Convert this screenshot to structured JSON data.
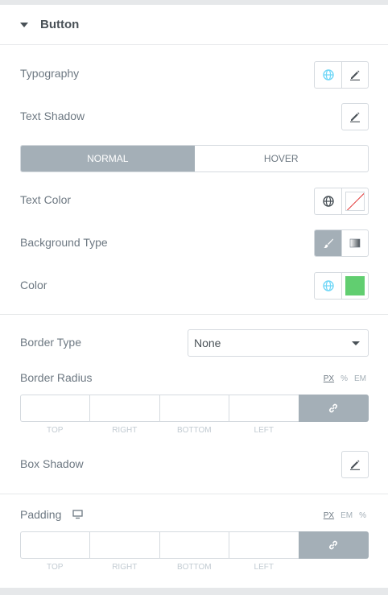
{
  "section": {
    "title": "Button"
  },
  "typography": {
    "label": "Typography"
  },
  "text_shadow": {
    "label": "Text Shadow"
  },
  "state_tabs": [
    {
      "label": "NORMAL",
      "active": true
    },
    {
      "label": "HOVER",
      "active": false
    }
  ],
  "text_color": {
    "label": "Text Color"
  },
  "background_type": {
    "label": "Background Type"
  },
  "color": {
    "label": "Color",
    "value": "#61ce70"
  },
  "border_type": {
    "label": "Border Type",
    "value": "None"
  },
  "border_radius": {
    "label": "Border Radius",
    "units": [
      "PX",
      "%",
      "EM"
    ],
    "selected_unit": "PX",
    "sides": [
      "TOP",
      "RIGHT",
      "BOTTOM",
      "LEFT"
    ]
  },
  "box_shadow": {
    "label": "Box Shadow"
  },
  "padding": {
    "label": "Padding",
    "units": [
      "PX",
      "EM",
      "%"
    ],
    "selected_unit": "PX",
    "sides": [
      "TOP",
      "RIGHT",
      "BOTTOM",
      "LEFT"
    ]
  },
  "colors": {
    "accent_active": "#a4afb7",
    "global_icon": "#71d7f7",
    "green": "#61ce70"
  }
}
